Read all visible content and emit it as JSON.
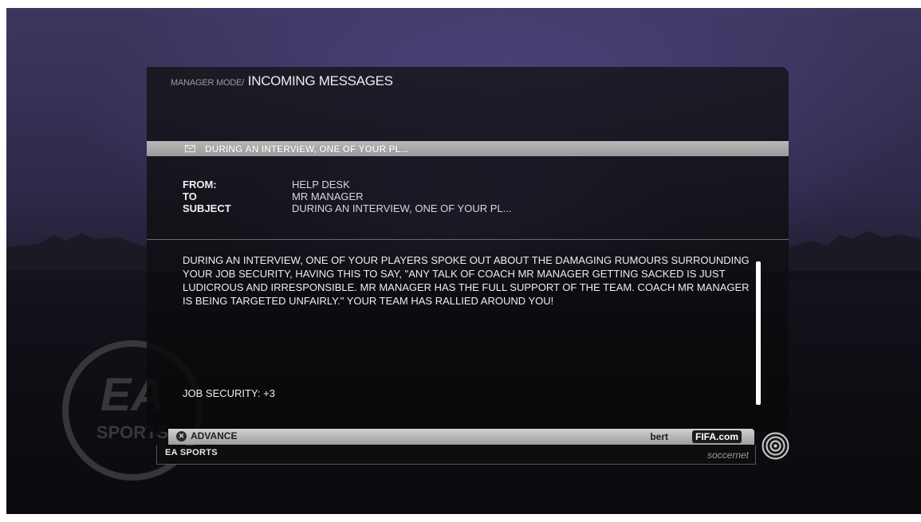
{
  "breadcrumb": {
    "root": "MANAGER MODE",
    "separator": "/",
    "title": "INCOMING MESSAGES"
  },
  "message_bar": {
    "icon": "envelope-icon",
    "subject": "DURING AN INTERVIEW, ONE OF YOUR PL..."
  },
  "header": {
    "from_label": "FROM:",
    "from_value": "HELP DESK",
    "to_label": "TO",
    "to_value": "MR MANAGER",
    "subject_label": "SUBJECT",
    "subject_value": "DURING AN INTERVIEW, ONE OF YOUR PL..."
  },
  "body": {
    "text": "DURING AN INTERVIEW, ONE OF YOUR PLAYERS SPOKE OUT ABOUT THE DAMAGING RUMOURS SURROUNDING YOUR JOB SECURITY, HAVING THIS TO SAY, \"ANY TALK OF COACH MR MANAGER GETTING SACKED IS JUST LUDICROUS AND IRRESPONSIBLE. MR MANAGER HAS THE FULL SUPPORT OF THE TEAM. COACH MR MANAGER IS BEING TARGETED UNFAIRLY.\" YOUR TEAM HAS RALLIED AROUND YOU!",
    "job_security": "JOB SECURITY: +3"
  },
  "footer": {
    "advance_button_icon": "x-button-icon",
    "advance_label": "ADVANCE",
    "username": "bert",
    "fifa_badge": "FIFA.com",
    "ea_sports_label": "EA SPORTS",
    "espn_label": "soccernet"
  },
  "logos": {
    "ea_watermark": "EA SPORTS"
  },
  "colors": {
    "message_bar": "#a8a8a8",
    "panel": "#121216",
    "text": "#eeeeee"
  }
}
